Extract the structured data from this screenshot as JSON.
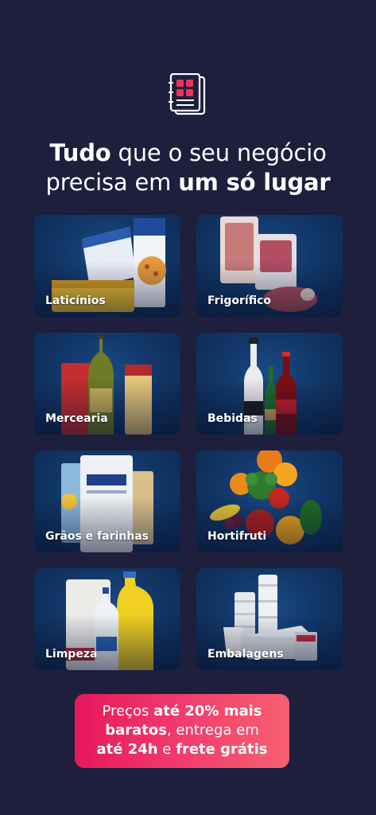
{
  "logo": {
    "icon": "catalog-icon",
    "accent": "#e8345a"
  },
  "headline": {
    "part1": "Tudo",
    "part2": " que o seu negócio",
    "part3": "precisa em ",
    "part4": "um só lugar"
  },
  "categories": [
    {
      "label": "Laticínios"
    },
    {
      "label": "Frigorífico"
    },
    {
      "label": "Mercearia"
    },
    {
      "label": "Bebidas"
    },
    {
      "label": "Grãos e farinhas"
    },
    {
      "label": "Hortifruti"
    },
    {
      "label": "Limpeza"
    },
    {
      "label": "Embalagens"
    }
  ],
  "promo": {
    "p1": "Preços ",
    "p2": "até 20% mais",
    "p3": "baratos",
    "p4": ", entrega em",
    "p5": "até 24h",
    "p6": " e ",
    "p7": "frete grátis"
  },
  "colors": {
    "background": "#1d1f3d",
    "card": "#123869",
    "promo_start": "#e8175d",
    "promo_end": "#f7606f"
  }
}
